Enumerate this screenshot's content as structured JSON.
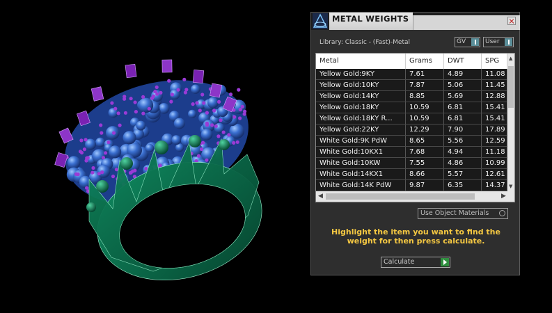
{
  "panel": {
    "title": "METAL WEIGHTS",
    "library_label": "Library: Classic - (Fast)-Metal",
    "toggles": {
      "gv": "GV",
      "user": "User"
    },
    "table": {
      "columns": [
        "Metal",
        "Grams",
        "DWT",
        "SPG"
      ],
      "rows": [
        [
          "Yellow Gold:9KY",
          "7.61",
          "4.89",
          "11.08"
        ],
        [
          "Yellow Gold:10KY",
          "7.87",
          "5.06",
          "11.45"
        ],
        [
          "Yellow Gold:14KY",
          "8.85",
          "5.69",
          "12.88"
        ],
        [
          "Yellow Gold:18KY",
          "10.59",
          "6.81",
          "15.41"
        ],
        [
          "Yellow Gold:18KY R...",
          "10.59",
          "6.81",
          "15.41"
        ],
        [
          "Yellow Gold:22KY",
          "12.29",
          "7.90",
          "17.89"
        ],
        [
          "White Gold:9K PdW",
          "8.65",
          "5.56",
          "12.59"
        ],
        [
          "White Gold:10KX1",
          "7.68",
          "4.94",
          "11.18"
        ],
        [
          "White Gold:10KW",
          "7.55",
          "4.86",
          "10.99"
        ],
        [
          "White Gold:14KX1",
          "8.66",
          "5.57",
          "12.61"
        ],
        [
          "White Gold:14K PdW",
          "9.87",
          "6.35",
          "14.37"
        ]
      ]
    },
    "use_object_materials": "Use Object Materials",
    "instructions": "Highlight the item you want to find the weight for then press calculate.",
    "calculate": "Calculate"
  },
  "colors": {
    "ring_green": "#0f7a55",
    "bead_blue": "#2f63c8",
    "prong_purple": "#8a2fc0",
    "instruction_yellow": "#f5c842"
  }
}
